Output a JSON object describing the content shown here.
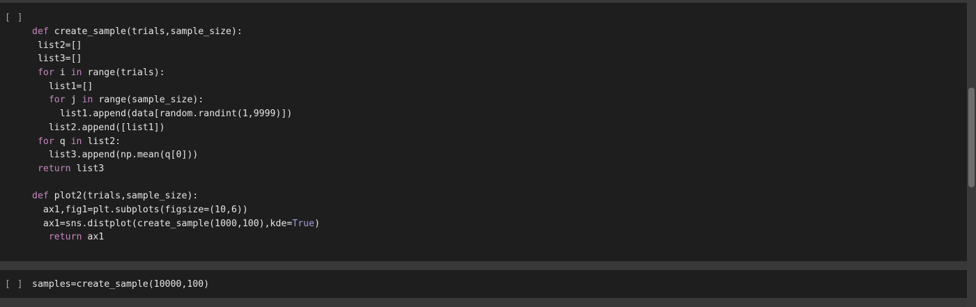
{
  "cells": [
    {
      "run_label": "[ ]",
      "lines": [
        {
          "indent": "",
          "parts": [
            {
              "t": "def",
              "c": "kw"
            },
            {
              "t": " create_sample(trials,sample_size):",
              "c": ""
            }
          ]
        },
        {
          "indent": " ",
          "parts": [
            {
              "t": "list2=[]",
              "c": ""
            }
          ]
        },
        {
          "indent": " ",
          "parts": [
            {
              "t": "list3=[]",
              "c": ""
            }
          ]
        },
        {
          "indent": " ",
          "parts": [
            {
              "t": "for",
              "c": "kw"
            },
            {
              "t": " i ",
              "c": ""
            },
            {
              "t": "in",
              "c": "kw"
            },
            {
              "t": " range(trials):",
              "c": ""
            }
          ]
        },
        {
          "indent": "   ",
          "parts": [
            {
              "t": "list1=[]",
              "c": ""
            }
          ]
        },
        {
          "indent": "   ",
          "parts": [
            {
              "t": "for",
              "c": "kw"
            },
            {
              "t": " j ",
              "c": ""
            },
            {
              "t": "in",
              "c": "kw"
            },
            {
              "t": " range(sample_size):",
              "c": ""
            }
          ]
        },
        {
          "indent": "     ",
          "parts": [
            {
              "t": "list1.append(data[random.randint(1,9999)])",
              "c": ""
            }
          ]
        },
        {
          "indent": "   ",
          "parts": [
            {
              "t": "list2.append([list1])",
              "c": ""
            }
          ]
        },
        {
          "indent": " ",
          "parts": [
            {
              "t": "for",
              "c": "kw"
            },
            {
              "t": " q ",
              "c": ""
            },
            {
              "t": "in",
              "c": "kw"
            },
            {
              "t": " list2:",
              "c": ""
            }
          ]
        },
        {
          "indent": "   ",
          "parts": [
            {
              "t": "list3.append(np.mean(q[0]))",
              "c": ""
            }
          ]
        },
        {
          "indent": " ",
          "parts": [
            {
              "t": "return",
              "c": "kw"
            },
            {
              "t": " list3",
              "c": ""
            }
          ]
        },
        {
          "indent": "",
          "parts": [
            {
              "t": "",
              "c": ""
            }
          ]
        },
        {
          "indent": "",
          "parts": [
            {
              "t": "def",
              "c": "kw"
            },
            {
              "t": " plot2(trials,sample_size):",
              "c": ""
            }
          ]
        },
        {
          "indent": "  ",
          "parts": [
            {
              "t": "ax1,fig1=plt.subplots(figsize=(10,6))",
              "c": ""
            }
          ]
        },
        {
          "indent": "  ",
          "parts": [
            {
              "t": "ax1=sns.distplot(create_sample(1000,100),kde=",
              "c": ""
            },
            {
              "t": "True",
              "c": "const"
            },
            {
              "t": ")",
              "c": ""
            }
          ]
        },
        {
          "indent": "   ",
          "parts": [
            {
              "t": "return",
              "c": "kw"
            },
            {
              "t": " ax1",
              "c": ""
            }
          ]
        }
      ]
    },
    {
      "run_label": "[ ]",
      "lines": [
        {
          "indent": "",
          "parts": [
            {
              "t": "samples=create_sample(10000,100)",
              "c": ""
            }
          ]
        }
      ]
    }
  ]
}
